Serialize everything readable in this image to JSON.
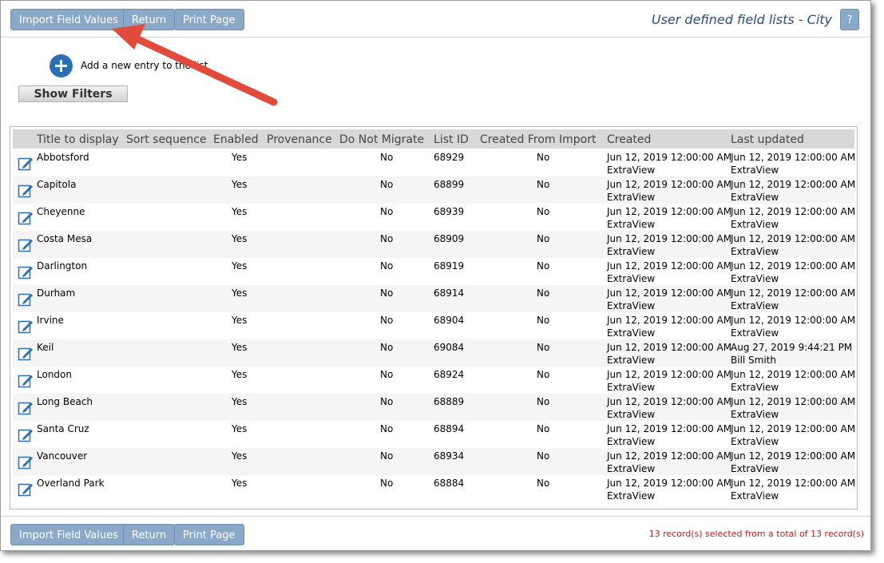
{
  "toolbar": {
    "import_label": "Import Field Values",
    "return_label": "Return",
    "print_label": "Print Page"
  },
  "page_title": "User defined field lists - City",
  "help_label": "?",
  "add_entry_text": "Add a new entry to the list",
  "show_filters_label": "Show Filters",
  "columns": [
    "Title to display",
    "Sort sequence",
    "Enabled",
    "Provenance",
    "Do Not Migrate",
    "List ID",
    "Created From Import",
    "Created",
    "Last updated"
  ],
  "rows": [
    {
      "title": "Abbotsford",
      "enabled": "Yes",
      "do_not_migrate": "No",
      "list_id": "68929",
      "created_from_import": "No",
      "created": "Jun 12, 2019 12:00:00 AM",
      "created_by": "ExtraView",
      "updated": "Jun 12, 2019 12:00:00 AM",
      "updated_by": "ExtraView"
    },
    {
      "title": "Capitola",
      "enabled": "Yes",
      "do_not_migrate": "No",
      "list_id": "68899",
      "created_from_import": "No",
      "created": "Jun 12, 2019 12:00:00 AM",
      "created_by": "ExtraView",
      "updated": "Jun 12, 2019 12:00:00 AM",
      "updated_by": "ExtraView"
    },
    {
      "title": "Cheyenne",
      "enabled": "Yes",
      "do_not_migrate": "No",
      "list_id": "68939",
      "created_from_import": "No",
      "created": "Jun 12, 2019 12:00:00 AM",
      "created_by": "ExtraView",
      "updated": "Jun 12, 2019 12:00:00 AM",
      "updated_by": "ExtraView"
    },
    {
      "title": "Costa Mesa",
      "enabled": "Yes",
      "do_not_migrate": "No",
      "list_id": "68909",
      "created_from_import": "No",
      "created": "Jun 12, 2019 12:00:00 AM",
      "created_by": "ExtraView",
      "updated": "Jun 12, 2019 12:00:00 AM",
      "updated_by": "ExtraView"
    },
    {
      "title": "Darlington",
      "enabled": "Yes",
      "do_not_migrate": "No",
      "list_id": "68919",
      "created_from_import": "No",
      "created": "Jun 12, 2019 12:00:00 AM",
      "created_by": "ExtraView",
      "updated": "Jun 12, 2019 12:00:00 AM",
      "updated_by": "ExtraView"
    },
    {
      "title": "Durham",
      "enabled": "Yes",
      "do_not_migrate": "No",
      "list_id": "68914",
      "created_from_import": "No",
      "created": "Jun 12, 2019 12:00:00 AM",
      "created_by": "ExtraView",
      "updated": "Jun 12, 2019 12:00:00 AM",
      "updated_by": "ExtraView"
    },
    {
      "title": "Irvine",
      "enabled": "Yes",
      "do_not_migrate": "No",
      "list_id": "68904",
      "created_from_import": "No",
      "created": "Jun 12, 2019 12:00:00 AM",
      "created_by": "ExtraView",
      "updated": "Jun 12, 2019 12:00:00 AM",
      "updated_by": "ExtraView"
    },
    {
      "title": "Keil",
      "enabled": "Yes",
      "do_not_migrate": "No",
      "list_id": "69084",
      "created_from_import": "No",
      "created": "Jun 12, 2019 12:00:00 AM",
      "created_by": "ExtraView",
      "updated": "Aug 27, 2019 9:44:21 PM",
      "updated_by": "Bill Smith"
    },
    {
      "title": "London",
      "enabled": "Yes",
      "do_not_migrate": "No",
      "list_id": "68924",
      "created_from_import": "No",
      "created": "Jun 12, 2019 12:00:00 AM",
      "created_by": "ExtraView",
      "updated": "Jun 12, 2019 12:00:00 AM",
      "updated_by": "ExtraView"
    },
    {
      "title": "Long Beach",
      "enabled": "Yes",
      "do_not_migrate": "No",
      "list_id": "68889",
      "created_from_import": "No",
      "created": "Jun 12, 2019 12:00:00 AM",
      "created_by": "ExtraView",
      "updated": "Jun 12, 2019 12:00:00 AM",
      "updated_by": "ExtraView"
    },
    {
      "title": "Santa Cruz",
      "enabled": "Yes",
      "do_not_migrate": "No",
      "list_id": "68894",
      "created_from_import": "No",
      "created": "Jun 12, 2019 12:00:00 AM",
      "created_by": "ExtraView",
      "updated": "Jun 12, 2019 12:00:00 AM",
      "updated_by": "ExtraView"
    },
    {
      "title": "Vancouver",
      "enabled": "Yes",
      "do_not_migrate": "No",
      "list_id": "68934",
      "created_from_import": "No",
      "created": "Jun 12, 2019 12:00:00 AM",
      "created_by": "ExtraView",
      "updated": "Jun 12, 2019 12:00:00 AM",
      "updated_by": "ExtraView"
    },
    {
      "title": "Overland Park",
      "enabled": "Yes",
      "do_not_migrate": "No",
      "list_id": "68884",
      "created_from_import": "No",
      "created": "Jun 12, 2019 12:00:00 AM",
      "created_by": "ExtraView",
      "updated": "Jun 12, 2019 12:00:00 AM",
      "updated_by": "ExtraView"
    }
  ],
  "footer": {
    "record_count": "13 record(s) selected from a total of 13 record(s)"
  },
  "colors": {
    "button": "#8aa9c9",
    "title": "#1f4e7d",
    "add_icon": "#2c6fb4",
    "annotation_arrow": "#e14b3b",
    "record_count": "#b22222"
  },
  "icons": {
    "add": "plus-circle-icon",
    "edit": "pencil-edit-icon"
  }
}
